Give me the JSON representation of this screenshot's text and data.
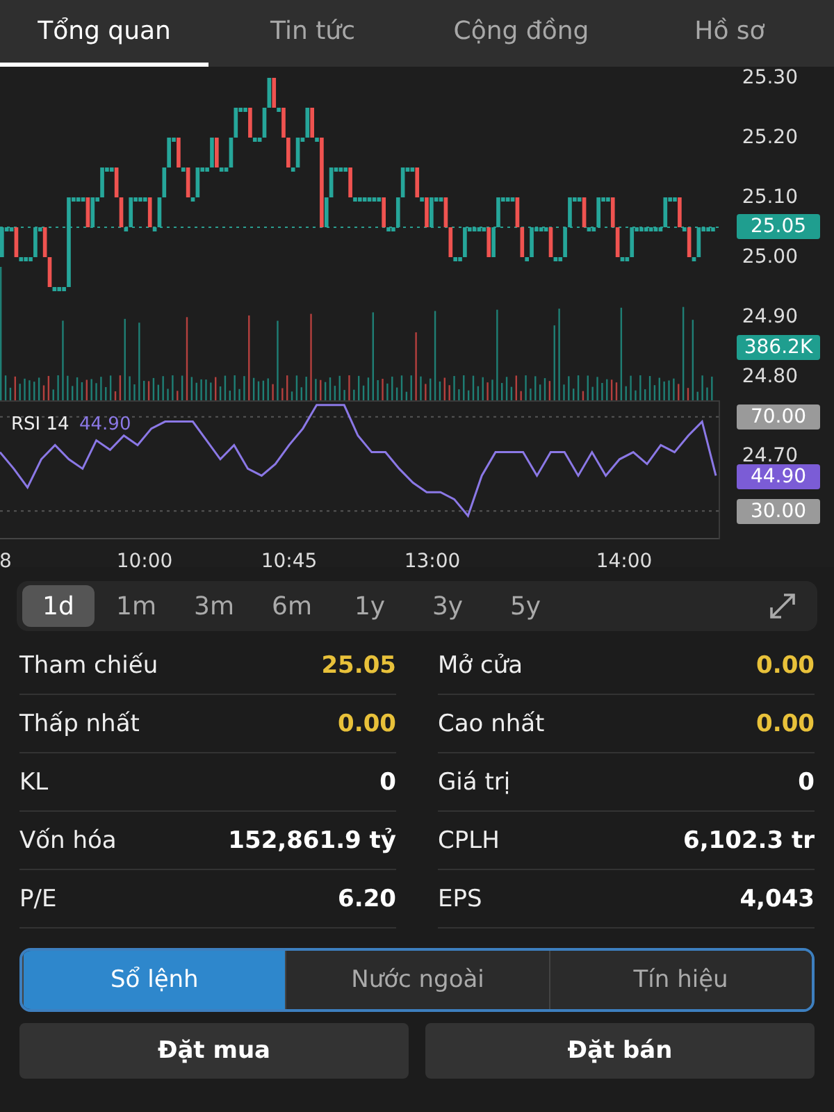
{
  "tabs": [
    {
      "label": "Tổng quan",
      "selected": true
    },
    {
      "label": "Tin tức",
      "selected": false
    },
    {
      "label": "Cộng đồng",
      "selected": false
    },
    {
      "label": "Hồ sơ",
      "selected": false
    }
  ],
  "chart": {
    "price_labels": [
      "25.30",
      "25.20",
      "25.10",
      "25.00",
      "24.90",
      "24.80",
      "24.70"
    ],
    "badges": [
      {
        "text": "25.05",
        "kind": "price"
      },
      {
        "text": "386.2K",
        "kind": "volume"
      },
      {
        "text": "44.90",
        "kind": "rsi"
      }
    ],
    "rsi": {
      "value": "44.90",
      "chart_data": {
        "type": "line",
        "series": [
          {
            "name": "RSI 14",
            "color": "#8b78e6",
            "values": [
              55,
              48,
              40,
              52,
              58,
              52,
              48,
              60,
              56,
              62,
              58,
              65,
              68,
              68,
              68,
              60,
              52,
              58,
              48,
              45,
              50,
              58,
              65,
              75,
              75,
              75,
              62,
              55,
              55,
              48,
              42,
              38,
              38,
              35,
              28,
              45,
              55,
              55,
              55,
              45,
              55,
              55,
              45,
              55,
              45,
              52,
              55,
              50,
              58,
              55,
              62,
              68,
              45
            ]
          }
        ],
        "ylim": [
          18,
          77
        ],
        "yticks": [
          {
            "value": 70,
            "label": "70.00"
          },
          {
            "value": 30,
            "label": "30.00"
          }
        ]
      }
    },
    "time_labels": [
      "8",
      "10:00",
      "10:45",
      "13:00",
      "14:00"
    ]
  },
  "periods": [
    {
      "label": "1d",
      "selected": true
    },
    {
      "label": "1m",
      "selected": false
    },
    {
      "label": "3m",
      "selected": false
    },
    {
      "label": "6m",
      "selected": false
    },
    {
      "label": "1y",
      "selected": false
    },
    {
      "label": "3y",
      "selected": false
    },
    {
      "label": "5y",
      "selected": false
    }
  ],
  "stats": [
    {
      "label": "Tham chiếu",
      "value": "25.05",
      "highlight": true
    },
    {
      "label": "Mở cửa",
      "value": "0.00",
      "highlight": true
    },
    {
      "label": "Thấp nhất",
      "value": "0.00",
      "highlight": true
    },
    {
      "label": "Cao nhất",
      "value": "0.00",
      "highlight": true
    },
    {
      "label": "KL",
      "value": "0",
      "highlight": false
    },
    {
      "label": "Giá trị",
      "value": "0",
      "highlight": false
    },
    {
      "label": "Vốn hóa",
      "value": "152,861.9 tỷ",
      "highlight": false
    },
    {
      "label": "CPLH",
      "value": "6,102.3 tr",
      "highlight": false
    },
    {
      "label": "P/E",
      "value": "6.20",
      "highlight": false
    },
    {
      "label": "EPS",
      "value": "4,043",
      "highlight": false
    }
  ],
  "segments": [
    {
      "label": "Sổ lệnh",
      "selected": true
    },
    {
      "label": "Nước ngoài",
      "selected": false
    },
    {
      "label": "Tín hiệu",
      "selected": false
    }
  ],
  "actions": [
    "Đặt mua",
    "Đặt bán"
  ]
}
